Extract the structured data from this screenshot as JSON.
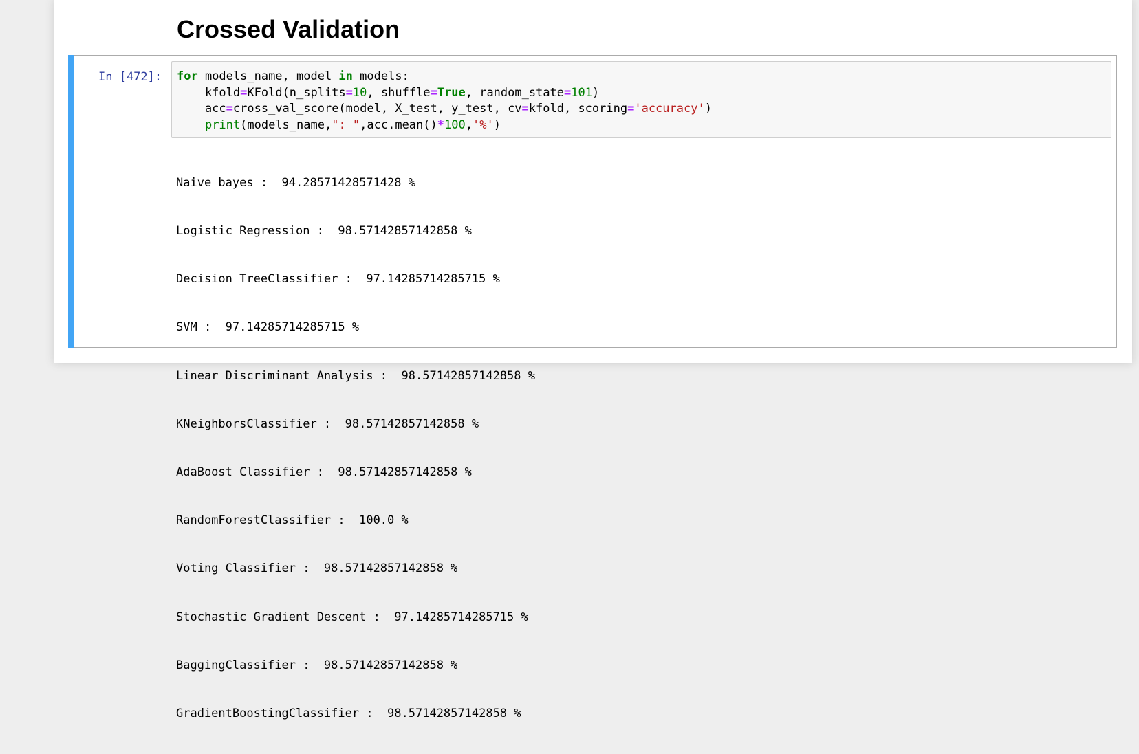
{
  "heading": "Crossed Validation",
  "cell": {
    "prompt": "In [472]:",
    "code": {
      "line1": {
        "kw_for": "for",
        "text1": " models_name, model ",
        "kw_in": "in",
        "text2": " models:"
      },
      "line2": {
        "indent": "    kfold",
        "eq1": "=",
        "text1": "KFold(n_splits",
        "eq2": "=",
        "num1": "10",
        "text2": ", shuffle",
        "eq3": "=",
        "kw_true": "True",
        "text3": ", random_state",
        "eq4": "=",
        "num2": "101",
        "text4": ")"
      },
      "line3": {
        "indent": "    acc",
        "eq1": "=",
        "text1": "cross_val_score(model, X_test, y_test, cv",
        "eq2": "=",
        "text2": "kfold, scoring",
        "eq3": "=",
        "str1": "'accuracy'",
        "text3": ")"
      },
      "line4": {
        "indent": "    ",
        "builtin": "print",
        "text1": "(models_name,",
        "str1": "\": \"",
        "text2": ",acc.mean()",
        "op": "*",
        "num1": "100",
        "text3": ",",
        "str2": "'%'",
        "text4": ")"
      }
    },
    "output": [
      "Naive bayes :  94.28571428571428 %",
      "Logistic Regression :  98.57142857142858 %",
      "Decision TreeClassifier :  97.14285714285715 %",
      "SVM :  97.14285714285715 %",
      "Linear Discriminant Analysis :  98.57142857142858 %",
      "KNeighborsClassifier :  98.57142857142858 %",
      "AdaBoost Classifier :  98.57142857142858 %",
      "RandomForestClassifier :  100.0 %",
      "Voting Classifier :  98.57142857142858 %",
      "Stochastic Gradient Descent :  97.14285714285715 %",
      "BaggingClassifier :  98.57142857142858 %",
      "GradientBoostingClassifier :  98.57142857142858 %"
    ]
  },
  "colors": {
    "keyword": "#008000",
    "operator": "#aa22ff",
    "string": "#ba2121",
    "prompt": "#303f9f",
    "selected_cell_bar": "#42a5f5"
  }
}
